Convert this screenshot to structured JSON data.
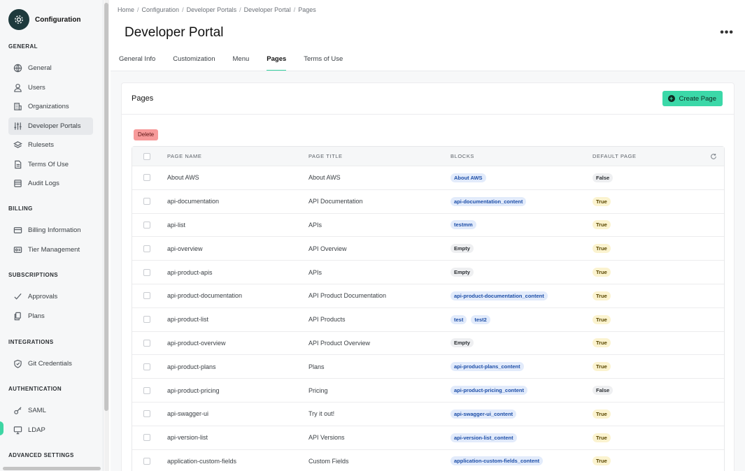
{
  "sidebar": {
    "brand": "Configuration",
    "sections": [
      {
        "title": "GENERAL",
        "items": [
          {
            "label": "General",
            "icon": "globe-icon"
          },
          {
            "label": "Users",
            "icon": "user-icon"
          },
          {
            "label": "Organizations",
            "icon": "building-icon"
          },
          {
            "label": "Developer Portals",
            "icon": "sliders-icon",
            "active": true
          },
          {
            "label": "Rulesets",
            "icon": "layers-icon"
          },
          {
            "label": "Terms Of Use",
            "icon": "document-icon"
          },
          {
            "label": "Audit Logs",
            "icon": "list-icon"
          }
        ]
      },
      {
        "title": "BILLING",
        "items": [
          {
            "label": "Billing Information",
            "icon": "card-icon"
          },
          {
            "label": "Tier Management",
            "icon": "tier-icon"
          }
        ]
      },
      {
        "title": "SUBSCRIPTIONS",
        "items": [
          {
            "label": "Approvals",
            "icon": "check-icon"
          },
          {
            "label": "Plans",
            "icon": "plans-icon"
          }
        ]
      },
      {
        "title": "INTEGRATIONS",
        "items": [
          {
            "label": "Git Credentials",
            "icon": "shield-icon"
          }
        ]
      },
      {
        "title": "AUTHENTICATION",
        "items": [
          {
            "label": "SAML",
            "icon": "key-icon"
          },
          {
            "label": "LDAP",
            "icon": "monitor-icon"
          }
        ]
      },
      {
        "title": "ADVANCED SETTINGS",
        "items": []
      }
    ]
  },
  "breadcrumb": [
    "Home",
    "Configuration",
    "Developer Portals",
    "Developer Portal",
    "Pages"
  ],
  "page_title": "Developer Portal",
  "tabs": [
    {
      "label": "General Info"
    },
    {
      "label": "Customization"
    },
    {
      "label": "Menu"
    },
    {
      "label": "Pages",
      "active": true
    },
    {
      "label": "Terms of Use"
    }
  ],
  "card": {
    "title": "Pages",
    "create_label": "Create Page",
    "delete_label": "Delete"
  },
  "table": {
    "columns": [
      "PAGE NAME",
      "PAGE TITLE",
      "BLOCKS",
      "DEFAULT PAGE"
    ],
    "rows": [
      {
        "name": "About AWS",
        "title": "About AWS",
        "blocks": [
          {
            "label": "About AWS",
            "kind": "blue"
          }
        ],
        "default": "False"
      },
      {
        "name": "api-documentation",
        "title": "API Documentation",
        "blocks": [
          {
            "label": "api-documentation_content",
            "kind": "blue"
          }
        ],
        "default": "True"
      },
      {
        "name": "api-list",
        "title": "APIs",
        "blocks": [
          {
            "label": "testmm",
            "kind": "blue"
          }
        ],
        "default": "True"
      },
      {
        "name": "api-overview",
        "title": "API Overview",
        "blocks": [
          {
            "label": "Empty",
            "kind": "gray"
          }
        ],
        "default": "True"
      },
      {
        "name": "api-product-apis",
        "title": "APIs",
        "blocks": [
          {
            "label": "Empty",
            "kind": "gray"
          }
        ],
        "default": "True"
      },
      {
        "name": "api-product-documentation",
        "title": "API Product Documentation",
        "blocks": [
          {
            "label": "api-product-documentation_content",
            "kind": "blue"
          }
        ],
        "default": "True"
      },
      {
        "name": "api-product-list",
        "title": "API Products",
        "blocks": [
          {
            "label": "test",
            "kind": "blue"
          },
          {
            "label": "test2",
            "kind": "blue"
          }
        ],
        "default": "True"
      },
      {
        "name": "api-product-overview",
        "title": "API Product Overview",
        "blocks": [
          {
            "label": "Empty",
            "kind": "gray"
          }
        ],
        "default": "True"
      },
      {
        "name": "api-product-plans",
        "title": "Plans",
        "blocks": [
          {
            "label": "api-product-plans_content",
            "kind": "blue"
          }
        ],
        "default": "True"
      },
      {
        "name": "api-product-pricing",
        "title": "Pricing",
        "blocks": [
          {
            "label": "api-product-pricing_content",
            "kind": "blue"
          }
        ],
        "default": "False"
      },
      {
        "name": "api-swagger-ui",
        "title": "Try it out!",
        "blocks": [
          {
            "label": "api-swagger-ui_content",
            "kind": "blue"
          }
        ],
        "default": "True"
      },
      {
        "name": "api-version-list",
        "title": "API Versions",
        "blocks": [
          {
            "label": "api-version-list_content",
            "kind": "blue"
          }
        ],
        "default": "True"
      },
      {
        "name": "application-custom-fields",
        "title": "Custom Fields",
        "blocks": [
          {
            "label": "application-custom-fields_content",
            "kind": "blue"
          }
        ],
        "default": "True"
      }
    ]
  }
}
